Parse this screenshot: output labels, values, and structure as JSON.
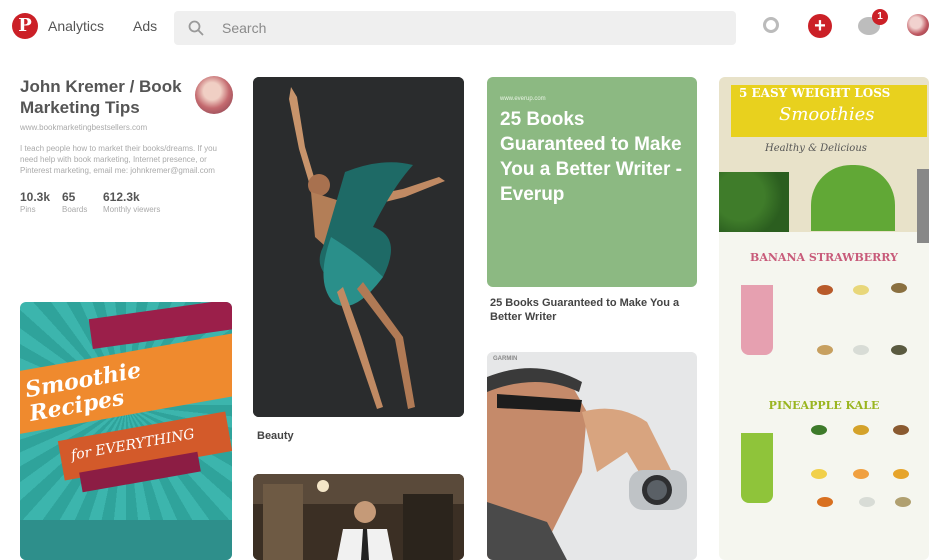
{
  "header": {
    "logo_letter": "P",
    "nav": [
      "Analytics",
      "Ads"
    ],
    "search_placeholder": "Search",
    "notification_count": "1",
    "plus_symbol": "+"
  },
  "profile": {
    "name": "John Kremer / Book Marketing Tips",
    "url": "www.bookmarketingbestsellers.com",
    "bio": "I teach people how to market their books/dreams. If you need help with book marketing, Internet presence, or Pinterest marketing, email me: johnkremer@gmail.com",
    "stats": [
      {
        "value": "10.3k",
        "label": "Pins"
      },
      {
        "value": "65",
        "label": "Boards"
      },
      {
        "value": "612.3k",
        "label": "Monthly viewers"
      }
    ]
  },
  "pins": {
    "smoothie": {
      "title": "Smoothie Recipes",
      "subtitle": "for EVERYTHING"
    },
    "dancer": {
      "caption": "Beauty"
    },
    "green": {
      "small": "www.everup.com",
      "title": "25 Books Guaranteed to Make You a Better Writer - Everup",
      "caption": "25 Books Guaranteed to Make You a Better Writer"
    },
    "runner": {
      "label": "GARMIN"
    },
    "info": {
      "title_line1": "5 EASY WEIGHT LOSS",
      "title_line2": "Smoothies",
      "title_line3": "Healthy & Delicious",
      "section1": "BANANA STRAWBERRY",
      "section2": "PINEAPPLE KALE"
    }
  },
  "colors": {
    "brand": "#cb2027",
    "green_pin": "#8cb982",
    "teal": "#3cb5ad",
    "orange": "#ef8a2e"
  }
}
